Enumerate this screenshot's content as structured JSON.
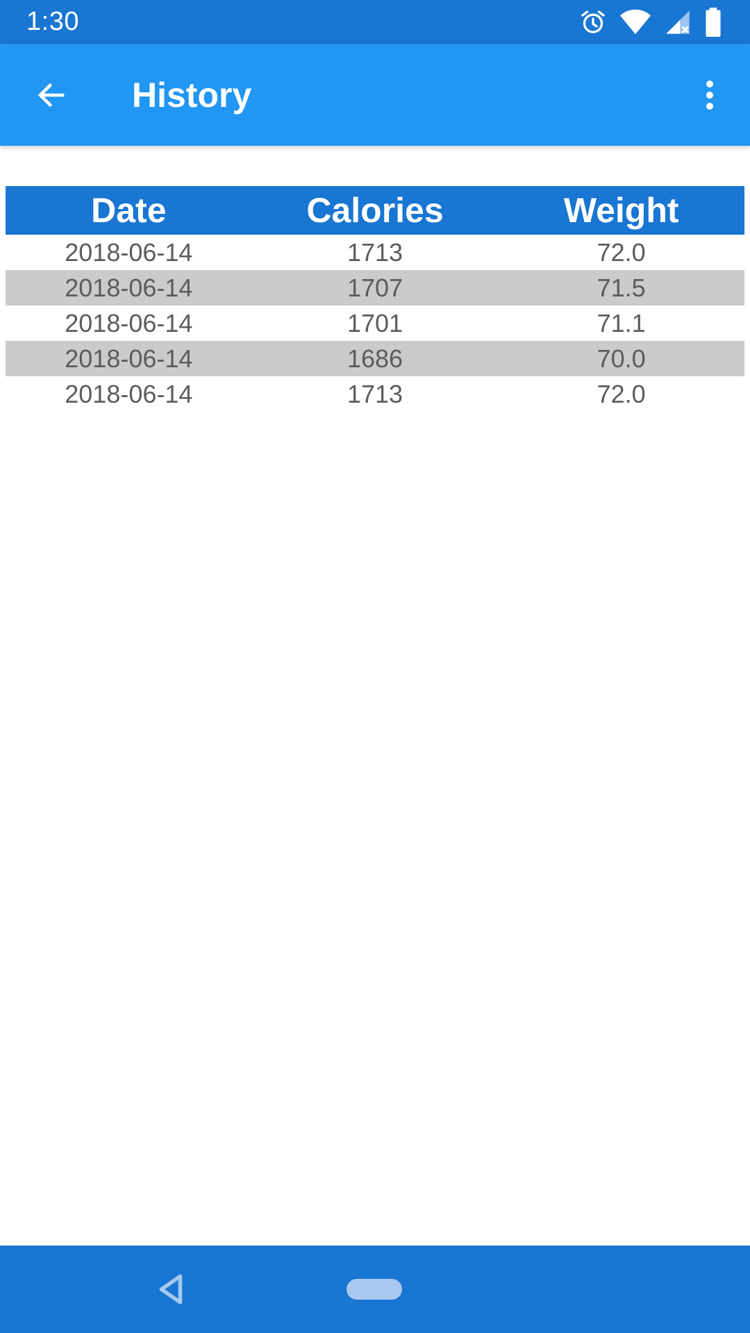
{
  "status_bar": {
    "time": "1:30",
    "icons": [
      "alarm-icon",
      "wifi-icon",
      "signal-icon",
      "battery-icon"
    ]
  },
  "app_bar": {
    "title": "History",
    "back_icon": "arrow-back-icon",
    "menu_icon": "more-vert-icon"
  },
  "table": {
    "columns": [
      "Date",
      "Calories",
      "Weight"
    ],
    "rows": [
      {
        "date": "2018-06-14",
        "calories": "1713",
        "weight": "72.0"
      },
      {
        "date": "2018-06-14",
        "calories": "1707",
        "weight": "71.5"
      },
      {
        "date": "2018-06-14",
        "calories": "1701",
        "weight": "71.1"
      },
      {
        "date": "2018-06-14",
        "calories": "1686",
        "weight": "70.0"
      },
      {
        "date": "2018-06-14",
        "calories": "1713",
        "weight": "72.0"
      }
    ]
  },
  "colors": {
    "status_bar": "#1976d2",
    "app_bar": "#2196f3",
    "table_header": "#1976d2",
    "row_alt": "#cbcbcb"
  },
  "nav_bar": {
    "back_icon": "nav-back-icon",
    "home_icon": "nav-home-pill"
  }
}
